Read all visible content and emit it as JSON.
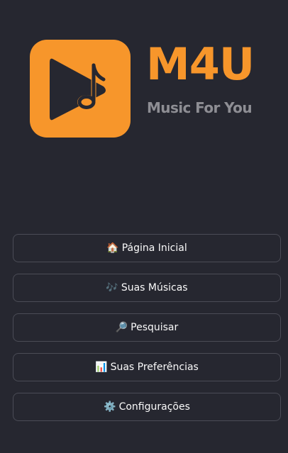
{
  "brand": {
    "name": "M4U",
    "tagline": "Music For You",
    "accent_color": "#f7962b",
    "tagline_color": "#8e8e94",
    "logo_icon": "play-music-note-icon"
  },
  "nav": {
    "items": [
      {
        "icon": "🏠",
        "icon_name": "house-icon",
        "label": "Página Inicial"
      },
      {
        "icon": "🎶",
        "icon_name": "music-notes-icon",
        "label": "Suas Músicas"
      },
      {
        "icon": "🔎",
        "icon_name": "magnifier-icon",
        "label": "Pesquisar"
      },
      {
        "icon": "📊",
        "icon_name": "bar-chart-icon",
        "label": "Suas Preferências"
      },
      {
        "icon": "⚙️",
        "icon_name": "gear-icon",
        "label": "Configurações"
      }
    ]
  },
  "colors": {
    "background": "#262730",
    "button_border": "#4b4c56",
    "text": "#fafafa"
  }
}
